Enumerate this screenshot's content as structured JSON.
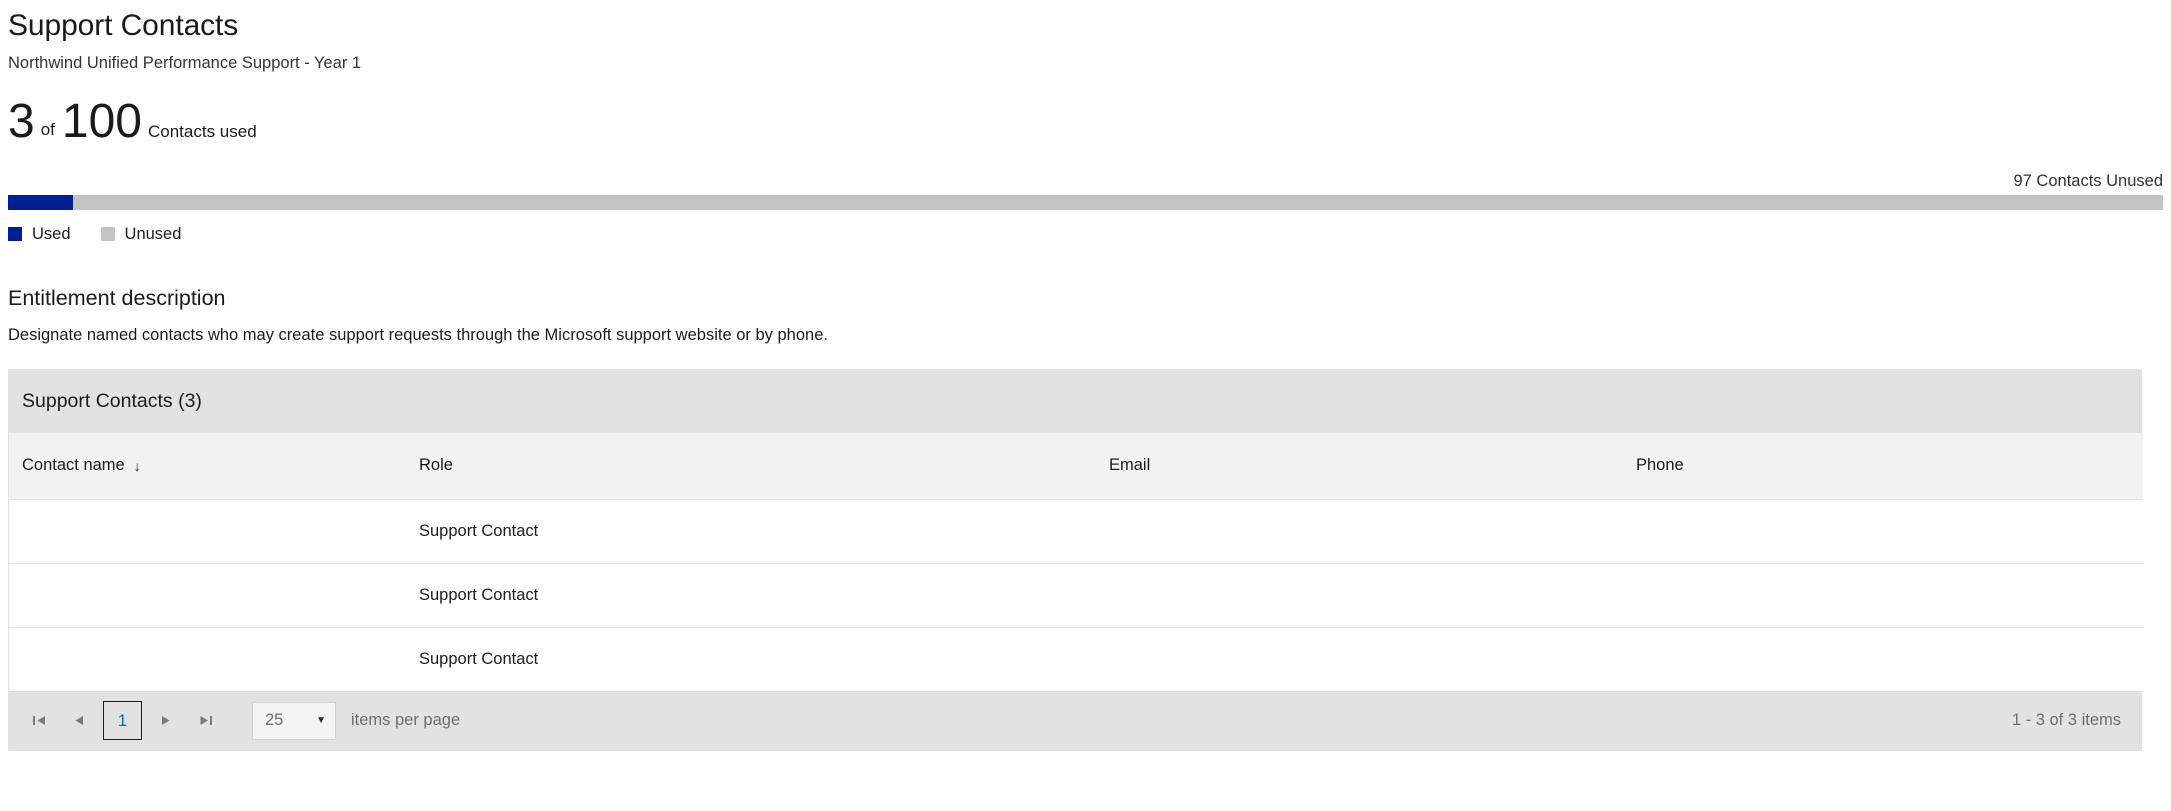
{
  "header": {
    "title": "Support Contacts",
    "subtitle": "Northwind Unified Performance Support - Year 1"
  },
  "usage": {
    "used": "3",
    "of_label": "of",
    "total": "100",
    "caption": "Contacts used",
    "unused_label": "97 Contacts Unused",
    "used_count": 3,
    "total_count": 100,
    "unused_count": 97,
    "percent_used": 3,
    "used_color": "#001f91",
    "unused_color": "#c3c3c3"
  },
  "legend": {
    "items": [
      {
        "label": "Used",
        "color": "#001f91",
        "name": "legend-swatch-used"
      },
      {
        "label": "Unused",
        "color": "#c3c3c3",
        "name": "legend-swatch-unused"
      }
    ]
  },
  "entitlement": {
    "title": "Entitlement description",
    "body": "Designate named contacts who may create support requests through the Microsoft support website or by phone."
  },
  "grid": {
    "toolbar_title": "Support Contacts (3)",
    "columns": [
      {
        "label": "Contact name",
        "sorted": true,
        "sort_icon": "↓"
      },
      {
        "label": "Role",
        "sorted": false,
        "sort_icon": ""
      },
      {
        "label": "Email",
        "sorted": false,
        "sort_icon": ""
      },
      {
        "label": "Phone",
        "sorted": false,
        "sort_icon": ""
      }
    ],
    "rows": [
      {
        "contact_name": "",
        "role": "Support Contact",
        "email": "",
        "phone": ""
      },
      {
        "contact_name": "",
        "role": "Support Contact",
        "email": "",
        "phone": ""
      },
      {
        "contact_name": "",
        "role": "Support Contact",
        "email": "",
        "phone": ""
      }
    ],
    "pager": {
      "first_icon": "first-page-icon",
      "prev_icon": "previous-page-icon",
      "current_page": "1",
      "next_icon": "next-page-icon",
      "last_icon": "last-page-icon",
      "page_size": "25",
      "page_size_caret": "▼",
      "items_per_page_label": "items per page",
      "range_label": "1 - 3 of 3 items"
    }
  },
  "chart_data": {
    "type": "bar",
    "title": "Contacts used",
    "categories": [
      "Used",
      "Unused"
    ],
    "values": [
      3,
      97
    ],
    "xlabel": "",
    "ylabel": "",
    "ylim": [
      0,
      100
    ],
    "legend_position": "bottom-left",
    "grid": false,
    "annotations": [
      "3 of 100 Contacts used",
      "97 Contacts Unused"
    ]
  }
}
